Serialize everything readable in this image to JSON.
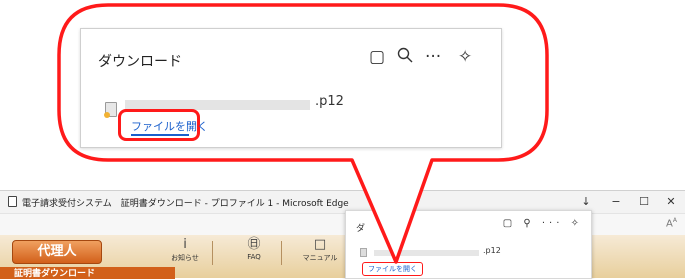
{
  "browser": {
    "window_title": "電子請求受付システム　証明書ダウンロード - プロファイル 1 - Microsoft Edge",
    "titlebar_buttons": [
      "↓",
      "−",
      "☐",
      "✕"
    ],
    "aa_icon": "Aᴬ"
  },
  "site": {
    "agent_button": "代理人",
    "nav_items": [
      {
        "glyph": "i",
        "label": "お知らせ",
        "icon": "info-icon"
      },
      {
        "glyph": "㊐",
        "label": "FAQ",
        "icon": "faq-icon"
      },
      {
        "glyph": "□",
        "label": "マニュアル",
        "icon": "manual-icon"
      }
    ],
    "cert_tab": "証明書ダウンロード",
    "right_text": "クト"
  },
  "download_panel": {
    "title": "ダウンロード",
    "icons": [
      "folder-icon",
      "search-icon",
      "more-icon",
      "pin-icon"
    ],
    "icon_glyphs": [
      "▢",
      "⚲",
      "···",
      "✧"
    ],
    "file_extension": ".p12",
    "open_file_label": "ファイルを開く"
  },
  "colors": {
    "callout_red": "#ff1a1a",
    "link_blue": "#1a5fcc",
    "agent_orange": "#d2601a"
  }
}
